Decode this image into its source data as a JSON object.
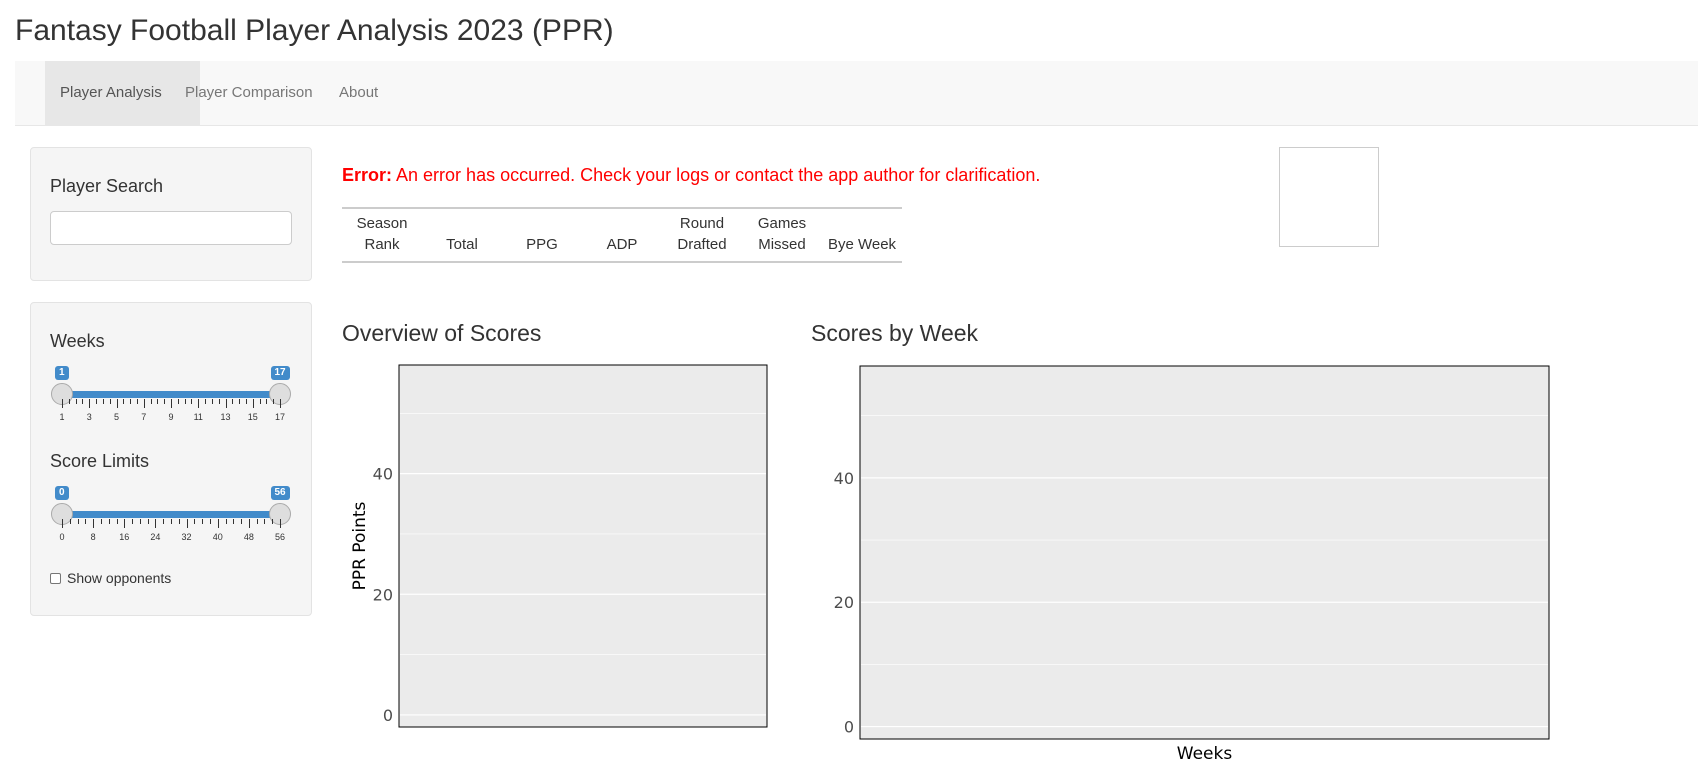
{
  "app": {
    "title": "Fantasy Football Player Analysis 2023 (PPR)"
  },
  "nav": {
    "tabs": [
      {
        "label": "Player Analysis",
        "active": true
      },
      {
        "label": "Player Comparison",
        "active": false
      },
      {
        "label": "About",
        "active": false
      }
    ]
  },
  "sidebar": {
    "search": {
      "label": "Player Search",
      "value": ""
    },
    "weeks": {
      "label": "Weeks",
      "min": 1,
      "max": 17,
      "from": 1,
      "to": 17,
      "ticks": [
        "1",
        "3",
        "5",
        "7",
        "9",
        "11",
        "13",
        "15",
        "17"
      ],
      "from_label": "1",
      "to_label": "17"
    },
    "score_limits": {
      "label": "Score Limits",
      "min": 0,
      "max": 56,
      "from": 0,
      "to": 56,
      "ticks": [
        "0",
        "8",
        "16",
        "24",
        "32",
        "40",
        "48",
        "56"
      ],
      "from_label": "0",
      "to_label": "56"
    },
    "show_opponents": {
      "label": "Show opponents",
      "checked": false
    }
  },
  "main": {
    "error": {
      "prefix": "Error:",
      "message": "An error has occurred. Check your logs or contact the app author for clarification."
    },
    "stats_table": {
      "headers": [
        "Season\nRank",
        "Total",
        "PPG",
        "ADP",
        "Round\nDrafted",
        "Games\nMissed",
        "Bye Week"
      ]
    },
    "overview": {
      "title": "Overview of Scores"
    },
    "weekly": {
      "title": "Scores by Week"
    }
  },
  "chart_data": [
    {
      "type": "bar",
      "title": "Overview of Scores",
      "xlabel": "",
      "ylabel": "PPR Points",
      "ylim": [
        -2,
        58
      ],
      "yticks": [
        "0",
        "20",
        "40"
      ],
      "series": [],
      "grid": true
    },
    {
      "type": "bar",
      "title": "Scores by Week",
      "xlabel": "Weeks",
      "ylabel": "",
      "ylim": [
        -2,
        58
      ],
      "yticks": [
        "0",
        "20",
        "40"
      ],
      "series": [],
      "grid": true
    }
  ],
  "colors": {
    "slider_accent": "#428bca",
    "error": "#ff0000",
    "panel_background": "#ebebeb",
    "gridline": "#ffffff",
    "navbar_background": "#f8f8f8",
    "active_tab_background": "#e7e7e7"
  }
}
